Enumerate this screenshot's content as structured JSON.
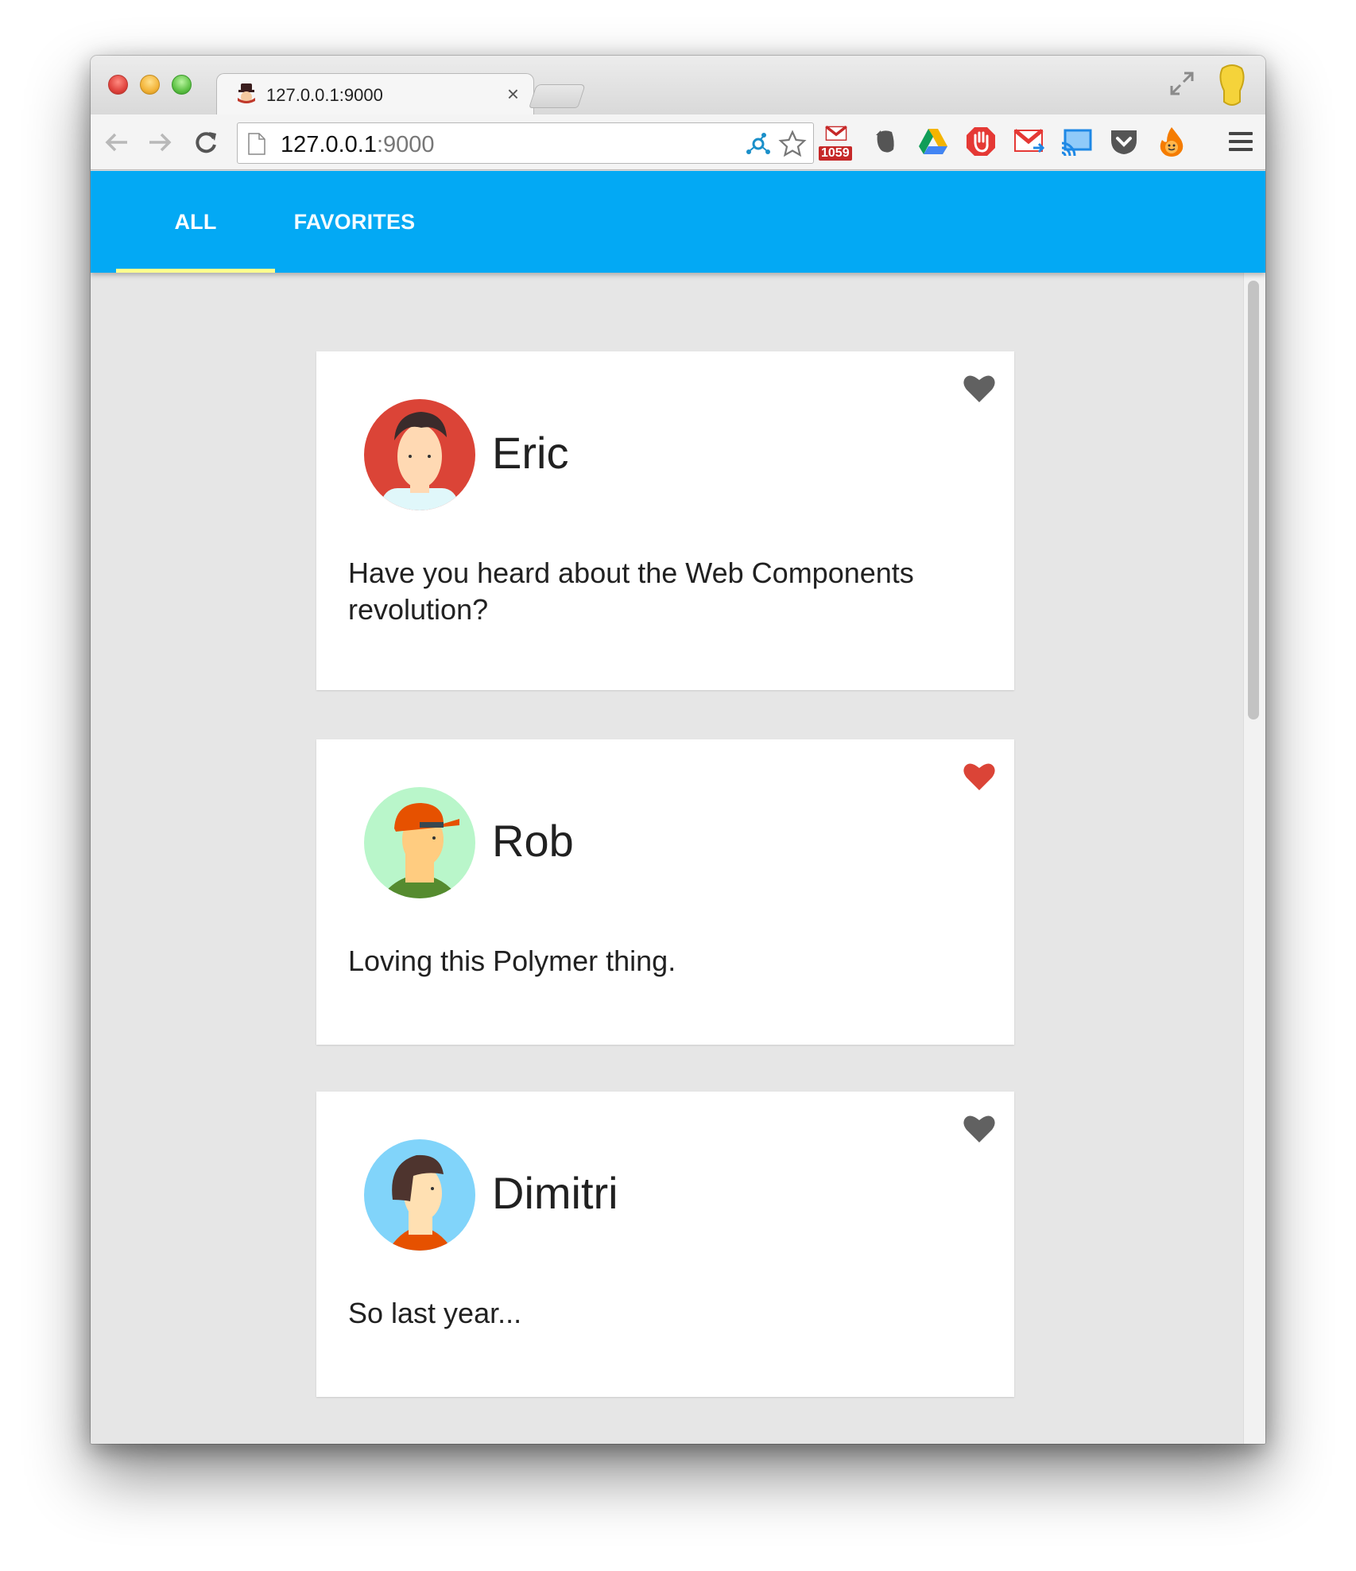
{
  "browser": {
    "tab_title": "127.0.0.1:9000",
    "tab_close": "×",
    "url_host": "127.0.0.1",
    "url_port": ":9000",
    "gmail_badge": "1059",
    "icons": [
      "back-arrow-icon",
      "forward-arrow-icon",
      "reload-icon",
      "page-icon",
      "star-icon",
      "gmail-icon",
      "evernote-icon",
      "drive-icon",
      "adblock-icon",
      "gmail-notifier-icon",
      "cast-icon",
      "pocket-icon",
      "fire-icon",
      "hamburger-menu-icon"
    ]
  },
  "app": {
    "accent_color": "#03a9f4",
    "ink_color": "#ffff8d",
    "tabs": [
      {
        "label": "ALL",
        "selected": true
      },
      {
        "label": "FAVORITES",
        "selected": false
      }
    ]
  },
  "posts": [
    {
      "name": "Eric",
      "text": "Have you heard about the Web Components revolution?",
      "favorite": false,
      "avatar_color": "#db4437"
    },
    {
      "name": "Rob",
      "text": "Loving this Polymer thing.",
      "favorite": true,
      "avatar_color": "#b9f6ca"
    },
    {
      "name": "Dimitri",
      "text": "So last year...",
      "favorite": false,
      "avatar_color": "#81d4fa"
    }
  ],
  "colors": {
    "heart_on": "#db4437",
    "heart_off": "#616161"
  }
}
